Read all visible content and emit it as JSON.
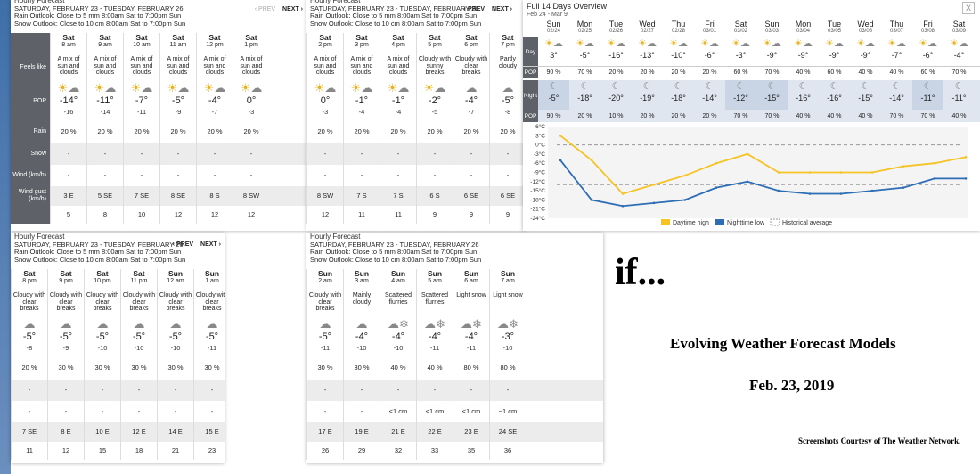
{
  "panel_header": {
    "title": "Hourly Forecast",
    "range": "SATURDAY, FEBRUARY 23 - TUESDAY, FEBRUARY 26",
    "rain_outlook": "Rain Outlook: Close to 5 mm 8:00am Sat to 7:00pm Sun",
    "snow_outlook": "Snow Outlook: Close to 10 cm 8:00am Sat to 7:00pm Sun",
    "prev": "‹ PREV",
    "next": "NEXT ›"
  },
  "row_labels": {
    "feels": "Feels like",
    "pop": "POP",
    "rain": "Rain",
    "snow": "Snow",
    "wind": "Wind (km/h)",
    "gust": "Wind gust (km/h)"
  },
  "panel1": {
    "cols": [
      {
        "day": "Sat",
        "time": "8 am",
        "cond": "A mix of sun and clouds",
        "temp": "-14°",
        "feels": "-16",
        "pop": "20 %",
        "rain": "-",
        "snow": "-",
        "wind": "3 E",
        "gust": "5",
        "icon": "sun-cloud"
      },
      {
        "day": "Sat",
        "time": "9 am",
        "cond": "A mix of sun and clouds",
        "temp": "-11°",
        "feels": "-14",
        "pop": "20 %",
        "rain": "-",
        "snow": "-",
        "wind": "5 SE",
        "gust": "8",
        "icon": "sun-cloud"
      },
      {
        "day": "Sat",
        "time": "10 am",
        "cond": "A mix of sun and clouds",
        "temp": "-7°",
        "feels": "-11",
        "pop": "20 %",
        "rain": "-",
        "snow": "-",
        "wind": "7 SE",
        "gust": "10",
        "icon": "sun-cloud"
      },
      {
        "day": "Sat",
        "time": "11 am",
        "cond": "A mix of sun and clouds",
        "temp": "-5°",
        "feels": "-9",
        "pop": "20 %",
        "rain": "-",
        "snow": "-",
        "wind": "8 SE",
        "gust": "12",
        "icon": "sun-cloud"
      },
      {
        "day": "Sat",
        "time": "12 pm",
        "cond": "A mix of sun and clouds",
        "temp": "-4°",
        "feels": "-7",
        "pop": "20 %",
        "rain": "-",
        "snow": "-",
        "wind": "8 S",
        "gust": "12",
        "icon": "sun-cloud"
      },
      {
        "day": "Sat",
        "time": "1 pm",
        "cond": "A mix of sun and clouds",
        "temp": "0°",
        "feels": "-3",
        "pop": "20 %",
        "rain": "-",
        "snow": "-",
        "wind": "8 SW",
        "gust": "12",
        "icon": "sun-cloud"
      }
    ]
  },
  "panel2": {
    "cols": [
      {
        "day": "Sat",
        "time": "2 pm",
        "cond": "A mix of sun and clouds",
        "temp": "0°",
        "feels": "-3",
        "pop": "20 %",
        "rain": "-",
        "snow": "-",
        "wind": "8 SW",
        "gust": "12",
        "icon": "sun-cloud"
      },
      {
        "day": "Sat",
        "time": "3 pm",
        "cond": "A mix of sun and clouds",
        "temp": "-1°",
        "feels": "-4",
        "pop": "20 %",
        "rain": "-",
        "snow": "-",
        "wind": "7 S",
        "gust": "11",
        "icon": "sun-cloud"
      },
      {
        "day": "Sat",
        "time": "4 pm",
        "cond": "A mix of sun and clouds",
        "temp": "-1°",
        "feels": "-4",
        "pop": "20 %",
        "rain": "-",
        "snow": "-",
        "wind": "7 S",
        "gust": "11",
        "icon": "sun-cloud"
      },
      {
        "day": "Sat",
        "time": "5 pm",
        "cond": "Cloudy with sunny breaks",
        "temp": "-2°",
        "feels": "-5",
        "pop": "20 %",
        "rain": "-",
        "snow": "-",
        "wind": "6 S",
        "gust": "9",
        "icon": "sun-cloud"
      },
      {
        "day": "Sat",
        "time": "6 pm",
        "cond": "Cloudy with clear breaks",
        "temp": "-4°",
        "feels": "-7",
        "pop": "20 %",
        "rain": "-",
        "snow": "-",
        "wind": "6 SE",
        "gust": "9",
        "icon": "cloud"
      },
      {
        "day": "Sat",
        "time": "7 pm",
        "cond": "Partly cloudy",
        "temp": "-5°",
        "feels": "-8",
        "pop": "20 %",
        "rain": "-",
        "snow": "-",
        "wind": "6 SE",
        "gust": "9",
        "icon": "cloud"
      }
    ]
  },
  "panel3": {
    "cols": [
      {
        "day": "Sat",
        "time": "8 pm",
        "cond": "Cloudy with clear breaks",
        "temp": "-5°",
        "feels": "-8",
        "pop": "20 %",
        "rain": "-",
        "snow": "-",
        "wind": "7 SE",
        "gust": "11",
        "icon": "cloud"
      },
      {
        "day": "Sat",
        "time": "9 pm",
        "cond": "Cloudy with clear breaks",
        "temp": "-5°",
        "feels": "-9",
        "pop": "30 %",
        "rain": "-",
        "snow": "-",
        "wind": "8 E",
        "gust": "12",
        "icon": "cloud"
      },
      {
        "day": "Sat",
        "time": "10 pm",
        "cond": "Cloudy with clear breaks",
        "temp": "-5°",
        "feels": "-10",
        "pop": "30 %",
        "rain": "-",
        "snow": "-",
        "wind": "10 E",
        "gust": "15",
        "icon": "cloud"
      },
      {
        "day": "Sat",
        "time": "11 pm",
        "cond": "Cloudy with clear breaks",
        "temp": "-5°",
        "feels": "-10",
        "pop": "30 %",
        "rain": "-",
        "snow": "-",
        "wind": "12 E",
        "gust": "18",
        "icon": "cloud"
      },
      {
        "day": "Sun",
        "time": "12 am",
        "cond": "Cloudy with clear breaks",
        "temp": "-5°",
        "feels": "-10",
        "pop": "30 %",
        "rain": "-",
        "snow": "-",
        "wind": "14 E",
        "gust": "21",
        "icon": "cloud"
      },
      {
        "day": "Sun",
        "time": "1 am",
        "cond": "Cloudy with clear breaks",
        "temp": "-5°",
        "feels": "-11",
        "pop": "30 %",
        "rain": "-",
        "snow": "-",
        "wind": "15 E",
        "gust": "23",
        "icon": "cloud"
      }
    ]
  },
  "panel4": {
    "cols": [
      {
        "day": "Sun",
        "time": "2 am",
        "cond": "Cloudy with clear breaks",
        "temp": "-5°",
        "feels": "-11",
        "pop": "30 %",
        "rain": "-",
        "snow": "-",
        "wind": "17 E",
        "gust": "26",
        "icon": "cloud"
      },
      {
        "day": "Sun",
        "time": "3 am",
        "cond": "Mainly cloudy",
        "temp": "-4°",
        "feels": "-10",
        "pop": "30 %",
        "rain": "-",
        "snow": "-",
        "wind": "19 E",
        "gust": "29",
        "icon": "cloud"
      },
      {
        "day": "Sun",
        "time": "4 am",
        "cond": "Scattered flurries",
        "temp": "-4°",
        "feels": "-10",
        "pop": "40 %",
        "rain": "-",
        "snow": "<1 cm",
        "wind": "21 E",
        "gust": "32",
        "icon": "snow"
      },
      {
        "day": "Sun",
        "time": "5 am",
        "cond": "Scattered flurries",
        "temp": "-4°",
        "feels": "-11",
        "pop": "40 %",
        "rain": "-",
        "snow": "<1 cm",
        "wind": "22 E",
        "gust": "33",
        "icon": "snow"
      },
      {
        "day": "Sun",
        "time": "6 am",
        "cond": "Light snow",
        "temp": "-4°",
        "feels": "-11",
        "pop": "80 %",
        "rain": "-",
        "snow": "<1 cm",
        "wind": "23 E",
        "gust": "35",
        "icon": "snow"
      },
      {
        "day": "Sun",
        "time": "7 am",
        "cond": "Light snow",
        "temp": "-3°",
        "feels": "-10",
        "pop": "80 %",
        "rain": "-",
        "snow": "~1 cm",
        "wind": "24 SE",
        "gust": "36",
        "icon": "snow"
      }
    ]
  },
  "overview": {
    "title": "Full 14 Days Overview",
    "subtitle": "Feb 24 - Mar 9",
    "close": "X",
    "day_label": "Day",
    "night_label": "Night",
    "pop_label": "POP",
    "days": [
      {
        "dow": "Sun",
        "date": "02/24",
        "day_temp": "3°",
        "day_pop": "90 %",
        "night_temp": "-5°",
        "night_pop": "90 %"
      },
      {
        "dow": "Mon",
        "date": "02/25",
        "day_temp": "-5°",
        "day_pop": "70 %",
        "night_temp": "-18°",
        "night_pop": "20 %"
      },
      {
        "dow": "Tue",
        "date": "02/26",
        "day_temp": "-16°",
        "day_pop": "20 %",
        "night_temp": "-20°",
        "night_pop": "10 %"
      },
      {
        "dow": "Wed",
        "date": "02/27",
        "day_temp": "-13°",
        "day_pop": "20 %",
        "night_temp": "-19°",
        "night_pop": "20 %"
      },
      {
        "dow": "Thu",
        "date": "02/28",
        "day_temp": "-10°",
        "day_pop": "20 %",
        "night_temp": "-18°",
        "night_pop": "20 %"
      },
      {
        "dow": "Fri",
        "date": "03/01",
        "day_temp": "-6°",
        "day_pop": "20 %",
        "night_temp": "-14°",
        "night_pop": "20 %"
      },
      {
        "dow": "Sat",
        "date": "03/02",
        "day_temp": "-3°",
        "day_pop": "60 %",
        "night_temp": "-12°",
        "night_pop": "70 %"
      },
      {
        "dow": "Sun",
        "date": "03/03",
        "day_temp": "-9°",
        "day_pop": "70 %",
        "night_temp": "-15°",
        "night_pop": "70 %"
      },
      {
        "dow": "Mon",
        "date": "03/04",
        "day_temp": "-9°",
        "day_pop": "40 %",
        "night_temp": "-16°",
        "night_pop": "40 %"
      },
      {
        "dow": "Tue",
        "date": "03/05",
        "day_temp": "-9°",
        "day_pop": "60 %",
        "night_temp": "-16°",
        "night_pop": "40 %"
      },
      {
        "dow": "Wed",
        "date": "03/06",
        "day_temp": "-9°",
        "day_pop": "40 %",
        "night_temp": "-15°",
        "night_pop": "40 %"
      },
      {
        "dow": "Thu",
        "date": "03/07",
        "day_temp": "-7°",
        "day_pop": "40 %",
        "night_temp": "-14°",
        "night_pop": "70 %"
      },
      {
        "dow": "Fri",
        "date": "03/08",
        "day_temp": "-6°",
        "day_pop": "60 %",
        "night_temp": "-11°",
        "night_pop": "70 %"
      },
      {
        "dow": "Sat",
        "date": "03/09",
        "day_temp": "-4°",
        "day_pop": "70 %",
        "night_temp": "-11°",
        "night_pop": "40 %"
      }
    ]
  },
  "chart_data": {
    "type": "line",
    "x": [
      "02/24",
      "02/25",
      "02/26",
      "02/27",
      "02/28",
      "03/01",
      "03/02",
      "03/03",
      "03/04",
      "03/05",
      "03/06",
      "03/07",
      "03/08",
      "03/09"
    ],
    "series": [
      {
        "name": "Daytime high",
        "color": "#f5c324",
        "values": [
          3,
          -5,
          -16,
          -13,
          -10,
          -6,
          -3,
          -9,
          -9,
          -9,
          -9,
          -7,
          -6,
          -4
        ]
      },
      {
        "name": "Nighttime low",
        "color": "#2d6db5",
        "values": [
          -5,
          -18,
          -20,
          -19,
          -18,
          -14,
          -12,
          -15,
          -16,
          -16,
          -15,
          -14,
          -11,
          -11
        ]
      },
      {
        "name": "Historical average",
        "color": "#999999",
        "values": [
          0,
          0,
          0,
          0,
          0,
          0,
          0,
          0,
          0,
          0,
          0,
          0,
          0,
          0
        ],
        "low_values": [
          -13,
          -13,
          -13,
          -13,
          -13,
          -13,
          -13,
          -13,
          -13,
          -13,
          -13,
          -13,
          -13,
          -13
        ]
      }
    ],
    "yticks": [
      "6°C",
      "3°C",
      "0°C",
      "-3°C",
      "-6°C",
      "-9°C",
      "-12°C",
      "-15°C",
      "-18°C",
      "-21°C",
      "-24°C"
    ],
    "ylim": [
      -24,
      6
    ],
    "legend": "bottom",
    "grid": false
  },
  "slide": {
    "if_text": "if...",
    "title": "Evolving Weather Forecast Models",
    "date": "Feb. 23, 2019",
    "credit": "Screenshots Courtesy of The Weather Network."
  },
  "colors": {
    "label_bg": "#5f6168",
    "row_gray": "#ececec",
    "night_bg": "#dfe6ef",
    "accent_yellow": "#f5c324",
    "accent_blue": "#2d6db5"
  }
}
